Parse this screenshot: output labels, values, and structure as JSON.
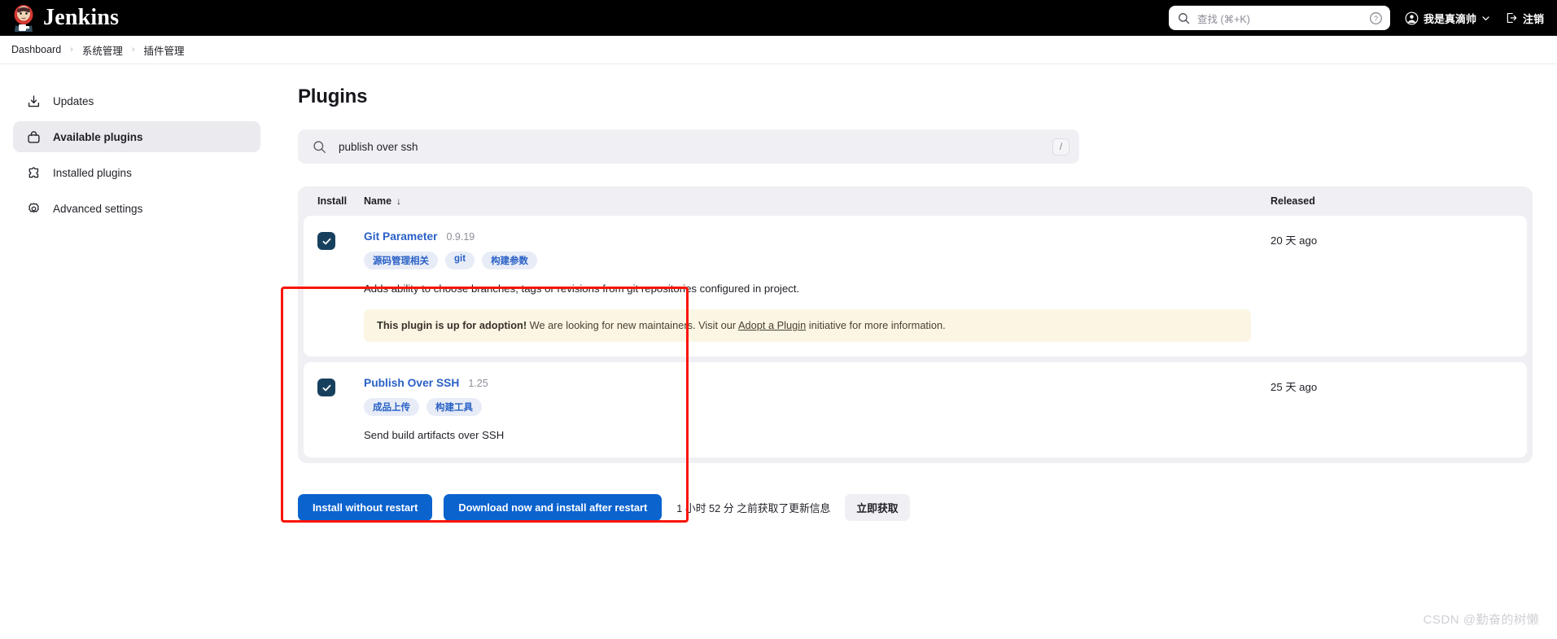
{
  "header": {
    "brand": "Jenkins",
    "search_placeholder": "查找 (⌘+K)",
    "help_icon": "help-circle-icon",
    "user_name": "我是真滴帅",
    "logout_label": "注销"
  },
  "breadcrumb": {
    "items": [
      "Dashboard",
      "系统管理",
      "插件管理"
    ],
    "separator": "›"
  },
  "sidebar": {
    "items": [
      {
        "label": "Updates",
        "icon": "download-box-icon",
        "active": false
      },
      {
        "label": "Available plugins",
        "icon": "plugin-bag-icon",
        "active": true
      },
      {
        "label": "Installed plugins",
        "icon": "puzzle-piece-icon",
        "active": false
      },
      {
        "label": "Advanced settings",
        "icon": "gear-icon",
        "active": false
      }
    ]
  },
  "main": {
    "title": "Plugins",
    "search": {
      "icon": "search-icon",
      "value": "publish over ssh",
      "shortcut_key": "/"
    },
    "table": {
      "columns": {
        "install": "Install",
        "name": "Name",
        "name_sort": "↓",
        "released": "Released"
      },
      "rows": [
        {
          "checked": true,
          "name": "Git Parameter",
          "version": "0.9.19",
          "tags": [
            "源码管理相关",
            "git",
            "构建参数"
          ],
          "description": "Adds ability to choose branches, tags or revisions from git repositories configured in project.",
          "notice": {
            "bold": "This plugin is up for adoption!",
            "text_before_link": " We are looking for new maintainers. Visit our ",
            "link": "Adopt a Plugin",
            "text_after_link": " initiative for more information."
          },
          "released": "20 天 ago"
        },
        {
          "checked": true,
          "name": "Publish Over SSH",
          "version": "1.25",
          "tags": [
            "成品上传",
            "构建工具"
          ],
          "description": "Send build artifacts over SSH",
          "notice": null,
          "released": "25 天 ago"
        }
      ]
    },
    "actions": {
      "install_without_restart": "Install without restart",
      "download_install_after_restart": "Download now and install after restart",
      "update_info": "1 小时 52 分 之前获取了更新信息",
      "check_now": "立即获取"
    }
  },
  "watermark": "CSDN @勤奋的树懒",
  "colors": {
    "accent_blue": "#0b63ce",
    "link_blue": "#2a61c6",
    "checkbox_navy": "#17405e",
    "annotation_red": "#fa1405",
    "notice_bg": "#fbf5e3",
    "panel_gray": "#f0f0f4"
  }
}
